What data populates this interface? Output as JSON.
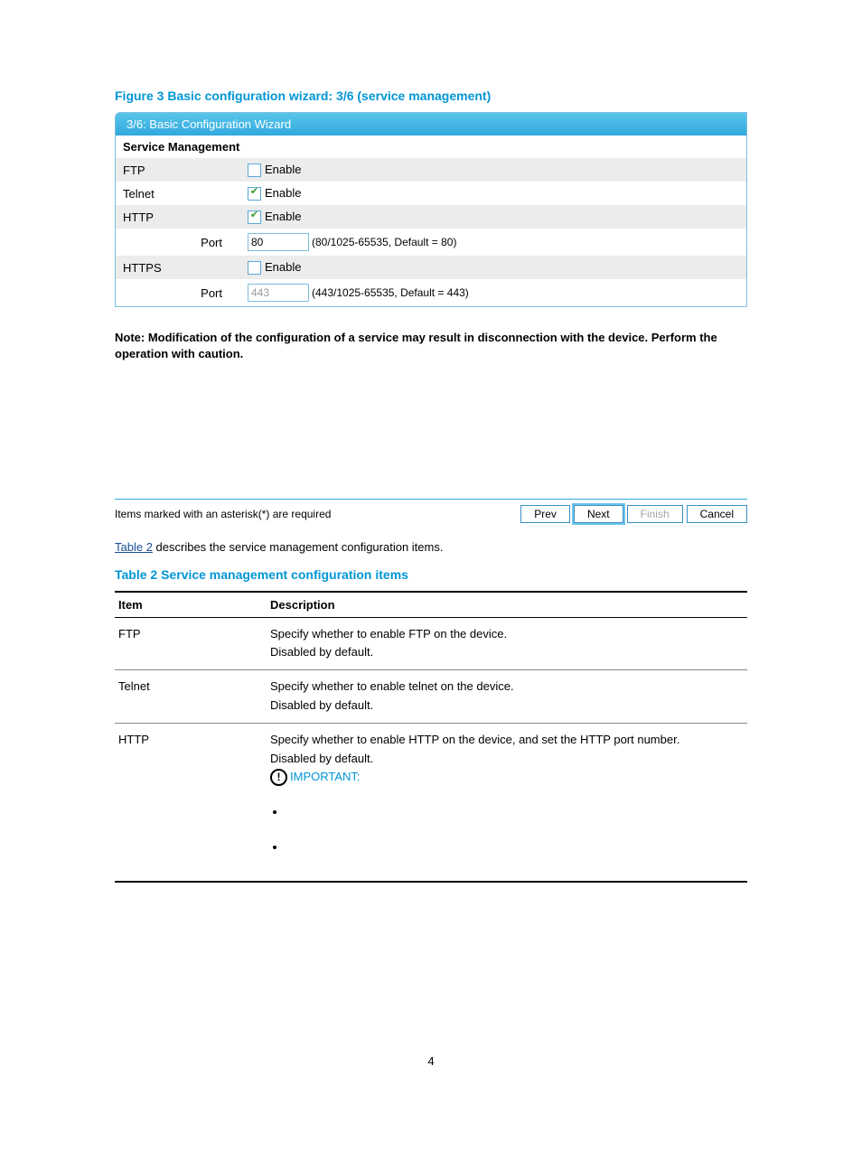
{
  "figure_caption": "Figure 3 Basic configuration wizard: 3/6 (service management)",
  "wizard": {
    "header": "3/6: Basic Configuration Wizard",
    "section_title": "Service Management",
    "rows": {
      "ftp": {
        "label": "FTP",
        "checkbox_label": "Enable"
      },
      "telnet": {
        "label": "Telnet",
        "checkbox_label": "Enable"
      },
      "http": {
        "label": "HTTP",
        "checkbox_label": "Enable"
      },
      "http_port": {
        "label": "Port",
        "value": "80",
        "hint": "(80/1025-65535, Default = 80)"
      },
      "https": {
        "label": "HTTPS",
        "checkbox_label": "Enable"
      },
      "https_port": {
        "label": "Port",
        "value": "443",
        "hint": "(443/1025-65535, Default = 443)"
      }
    },
    "note": "Note: Modification of the configuration of a service may result in disconnection with the device. Perform the operation with caution."
  },
  "footer": {
    "text": "Items marked with an asterisk(*) are required",
    "prev": "Prev",
    "next": "Next",
    "finish": "Finish",
    "cancel": "Cancel"
  },
  "body_sentence": {
    "link": "Table 2",
    "rest": " describes the service management configuration items."
  },
  "table_caption": "Table 2 Service management configuration items",
  "desc_table": {
    "header_item": "Item",
    "header_desc": "Description",
    "ftp": {
      "item": "FTP",
      "line1": "Specify whether to enable FTP on the device.",
      "line2": "Disabled by default."
    },
    "telnet": {
      "item": "Telnet",
      "line1": "Specify whether to enable telnet on the device.",
      "line2": "Disabled by default."
    },
    "http": {
      "item": "HTTP",
      "line1": "Specify whether to enable HTTP on the device, and set the HTTP port number.",
      "line2": "Disabled by default.",
      "important_label": "IMPORTANT:"
    }
  },
  "page_number": "4"
}
